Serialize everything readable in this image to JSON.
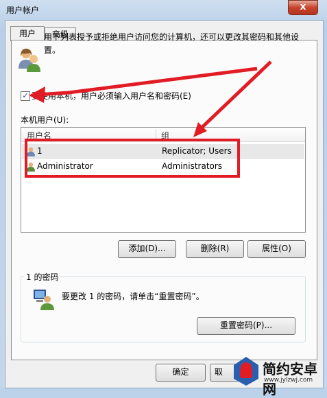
{
  "window": {
    "title": "用户帐户",
    "close_glyph": "x"
  },
  "tabs": [
    {
      "label": "用户"
    },
    {
      "label": "高级"
    }
  ],
  "description": "用下列表授予或拒绝用户访问您的计算机，还可以更改其密码和其他设置。",
  "require_login": {
    "checked": true,
    "check_glyph": "✓",
    "label": "要使用本机，用户必须输入用户名和密码(E)"
  },
  "users_list": {
    "label": "本机用户(U):",
    "columns": [
      "用户名",
      "组"
    ],
    "rows": [
      {
        "name": "1",
        "group": "Replicator; Users"
      },
      {
        "name": "Administrator",
        "group": "Administrators"
      }
    ]
  },
  "buttons": {
    "add": "添加(D)...",
    "remove": "删除(R)",
    "properties": "属性(O)",
    "reset_password": "重置密码(P)...",
    "ok": "确定",
    "cancel": "取"
  },
  "password_group": {
    "title": "1 的密码",
    "text": "要更改 1 的密码，请单击“重置密码”。"
  },
  "watermark": {
    "text": "简约安卓网",
    "url": "www.jylzwj.com"
  },
  "colors": {
    "annotation": "#e21c24",
    "window_frame": "#bcd2ea",
    "client_bg": "#f0f0f0"
  },
  "icons": {
    "users": "users-icon",
    "user": "user-icon",
    "computer": "computer-user-icon"
  }
}
